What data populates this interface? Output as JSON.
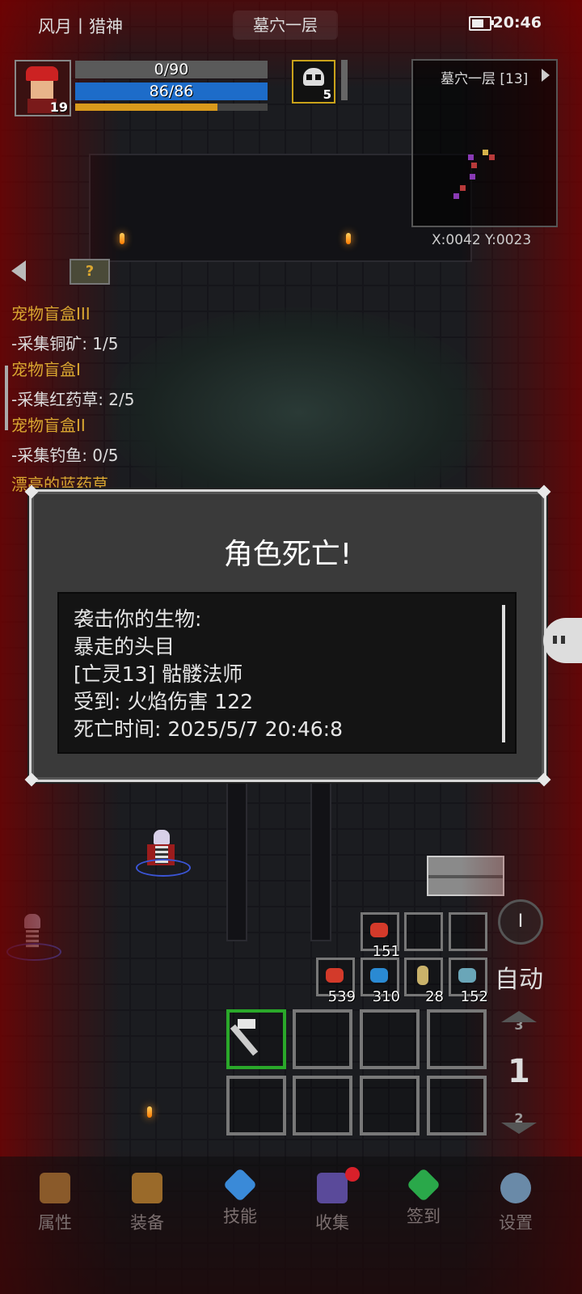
{
  "status_bar": {
    "left": "风月丨猎神",
    "center": "墓穴一层",
    "time": "20:46"
  },
  "player": {
    "level": "19",
    "shield_text": "0/90",
    "hp_text": "86/86",
    "xp_progress": 0.74,
    "pet_level": "5"
  },
  "minimap": {
    "title": "墓穴一层 [13]",
    "coords": "X:0042  Y:0023"
  },
  "quests": {
    "items": [
      {
        "title": "宠物盲盒III",
        "task": "-采集铜矿: 1/5"
      },
      {
        "title": "宠物盲盒I",
        "task": "-采集红药草: 2/5"
      },
      {
        "title": "宠物盲盒II",
        "task": "-采集钓鱼: 0/5"
      }
    ],
    "partial": "漂亮的蓝药草",
    "help_label": "?"
  },
  "death_dialog": {
    "title": "角色死亡!",
    "lines": [
      "袭击你的生物:",
      "暴走的头目",
      "[亡灵13] 骷髅法师",
      "受到: 火焰伤害 122",
      "死亡时间: 2025/5/7 20:46:8"
    ]
  },
  "hotbar": {
    "top_slot_count": "151",
    "consumables": [
      {
        "icon": "red-meat-icon",
        "count": "539",
        "color": "#d33a2a"
      },
      {
        "icon": "blue-fish-icon",
        "count": "310",
        "color": "#2a8ad3"
      },
      {
        "icon": "scroll-icon",
        "count": "28",
        "color": "#c9b26a"
      },
      {
        "icon": "fish-icon",
        "count": "152",
        "color": "#6aa6b8"
      }
    ]
  },
  "controls": {
    "refresh_label": "I",
    "auto_label": "自动",
    "floor_up": "3",
    "floor_current": "1",
    "floor_down": "2"
  },
  "nav": [
    {
      "label": "属性",
      "icon": "helmet-icon",
      "color": "#8a5a2a"
    },
    {
      "label": "装备",
      "icon": "bag-icon",
      "color": "#9a6a2a"
    },
    {
      "label": "技能",
      "icon": "crystal-icon",
      "color": "#3a8ad8"
    },
    {
      "label": "收集",
      "icon": "book-icon",
      "color": "#5a4a9a"
    },
    {
      "label": "签到",
      "icon": "gem-icon",
      "color": "#2aa84a"
    },
    {
      "label": "设置",
      "icon": "gear-icon",
      "color": "#6a8aa8"
    }
  ]
}
